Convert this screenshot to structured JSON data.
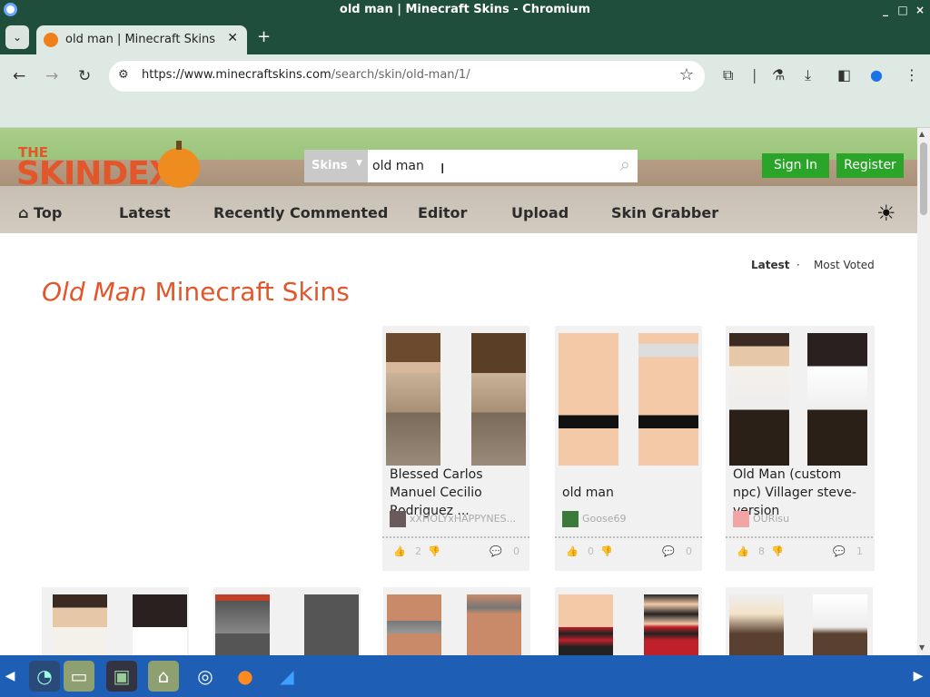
{
  "window": {
    "title": "old man | Minecraft Skins - Chromium",
    "minimize": "_",
    "maximize": "□",
    "close": "×"
  },
  "tabs": [
    {
      "label": "old man | Minecraft Skins"
    }
  ],
  "toolbar": {
    "url_host": "https://www.minecraftskins.com",
    "url_path": "/search/skin/old-man/1/"
  },
  "site": {
    "logo_the": "THE",
    "logo_name": "SKINDEX",
    "search": {
      "category": "Skins",
      "value": "old man"
    },
    "sign_in": "Sign In",
    "register": "Register",
    "nav": [
      "Top",
      "Latest",
      "Recently Commented",
      "Editor",
      "Upload",
      "Skin Grabber"
    ],
    "sort": {
      "latest": "Latest",
      "sep": "·",
      "most_voted": "Most Voted"
    },
    "title_query": "Old Man",
    "title_rest": " Minecraft Skins",
    "accent_color": "#e2562a",
    "button_color": "#2aa52a"
  },
  "skins": [
    {
      "name": "Blessed Carlos Manuel Cecilio Rodriguez ...",
      "author": "xXHOLYxHAPPYNES...",
      "likes": "2",
      "comments": "0"
    },
    {
      "name": "old man",
      "author": "Goose69",
      "likes": "0",
      "comments": "0"
    },
    {
      "name": "Old Man (custom npc) Villager steve-version",
      "author": "OURisu",
      "likes": "8",
      "comments": "1"
    }
  ],
  "taskbar": {
    "icons": [
      "show-desktop-icon",
      "file-manager-icon",
      "terminal-icon",
      "files-icon",
      "chromium-icon",
      "firefox-icon",
      "vscode-icon"
    ]
  }
}
